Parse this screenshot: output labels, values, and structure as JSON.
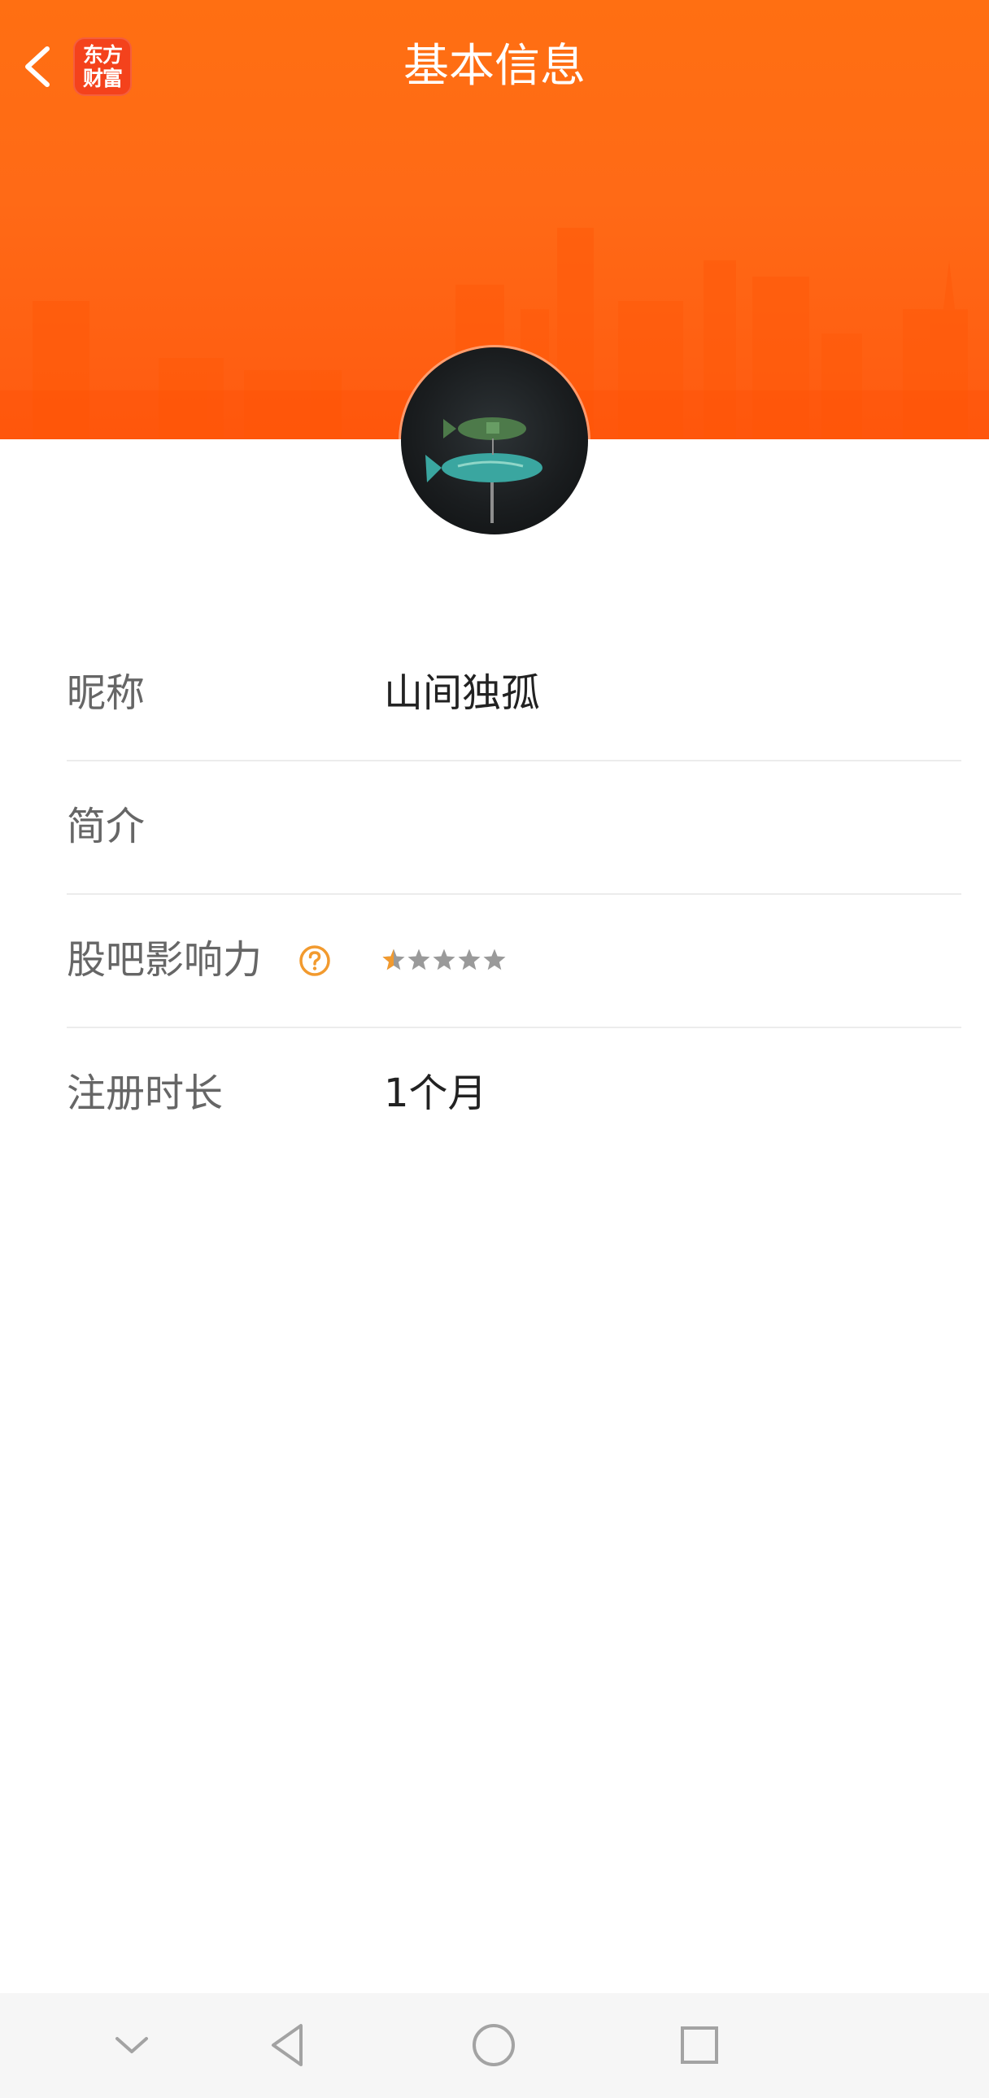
{
  "header": {
    "title": "基本信息",
    "logo_line1": "东方",
    "logo_line2": "财富",
    "brand_color": "#ff6a16"
  },
  "profile": {
    "rows": [
      {
        "label": "昵称",
        "value": "山间独孤"
      },
      {
        "label": "简介",
        "value": ""
      },
      {
        "label": "股吧影响力",
        "stars_filled": 0.5,
        "stars_total": 5,
        "help_icon": "question-circle-icon"
      },
      {
        "label": "注册时长",
        "value": "1个月"
      }
    ]
  },
  "icons": {
    "back": "chevron-left-icon",
    "avatar": "avatar-image",
    "nav": [
      "chevron-down-icon",
      "triangle-back-icon",
      "circle-home-icon",
      "square-recents-icon"
    ]
  },
  "colors": {
    "accent": "#f29a2e",
    "star_empty": "#9a9a9a",
    "label": "#666666",
    "value": "#222222"
  }
}
